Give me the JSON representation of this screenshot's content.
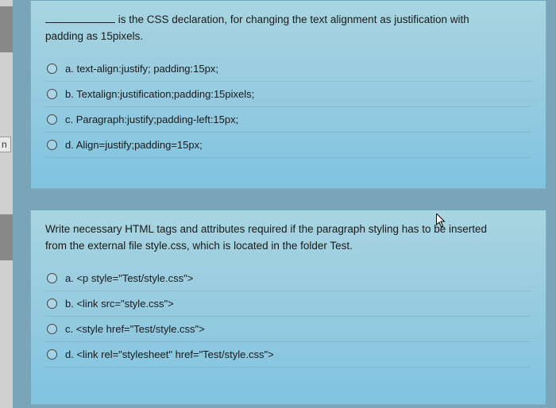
{
  "left_tab": "n",
  "q1": {
    "prompt_prefix": "",
    "prompt_suffix_a": " is the CSS declaration, for changing the text alignment as justification with",
    "prompt_line2": "padding as 15pixels.",
    "options": [
      {
        "label": "a. text-align:justify; padding:15px;"
      },
      {
        "label": "b. Textalign:justification;padding:15pixels;"
      },
      {
        "label": "c. Paragraph:justify;padding-left:15px;"
      },
      {
        "label": "d. Align=justify;padding=15px;"
      }
    ]
  },
  "q2": {
    "prompt_line1": "Write necessary HTML tags and attributes required if the paragraph styling has to be inserted",
    "prompt_line2": "from the external file style.css, which is located in the folder Test.",
    "options": [
      {
        "label": "a. <p style=\"Test/style.css\">"
      },
      {
        "label": "b. <link src=\"style.css\">"
      },
      {
        "label": "c. <style href=\"Test/style.css\">"
      },
      {
        "label": "d. <link rel=\"stylesheet\" href=\"Test/style.css\">"
      }
    ]
  }
}
